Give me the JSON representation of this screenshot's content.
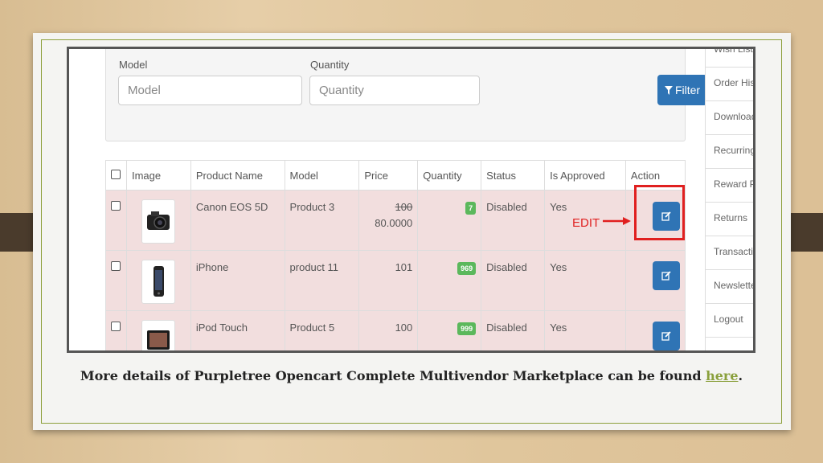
{
  "filters": {
    "model_label": "Model",
    "model_placeholder": "Model",
    "quantity_label": "Quantity",
    "quantity_placeholder": "Quantity",
    "filter_button": "Filter"
  },
  "table": {
    "headers": [
      "Image",
      "Product Name",
      "Model",
      "Price",
      "Quantity",
      "Status",
      "Is Approved",
      "Action"
    ],
    "rows": [
      {
        "name": "Canon EOS 5D",
        "model": "Product 3",
        "price_old": "100",
        "price": "80.0000",
        "quantity": "7",
        "status": "Disabled",
        "approved": "Yes"
      },
      {
        "name": "iPhone",
        "model": "product 11",
        "price": "101",
        "quantity": "969",
        "status": "Disabled",
        "approved": "Yes"
      },
      {
        "name": "iPod Touch",
        "model": "Product 5",
        "price": "100",
        "quantity": "999",
        "status": "Disabled",
        "approved": "Yes"
      }
    ]
  },
  "sidebar": {
    "items": [
      "Wish List",
      "Order History",
      "Downloads",
      "Recurring",
      "Reward Points",
      "Returns",
      "Transactions",
      "Newsletter",
      "Logout"
    ]
  },
  "annotation": {
    "edit_label": "EDIT",
    "color": "#e02020"
  },
  "caption": {
    "text": "More details of Purpletree Opencart Complete Multivendor Marketplace can be found",
    "link": "here",
    "end": "."
  },
  "colors": {
    "primary": "#2f74b5",
    "badge": "#5cb85c",
    "row_bg": "#f2dede",
    "accent": "#8da03c"
  }
}
